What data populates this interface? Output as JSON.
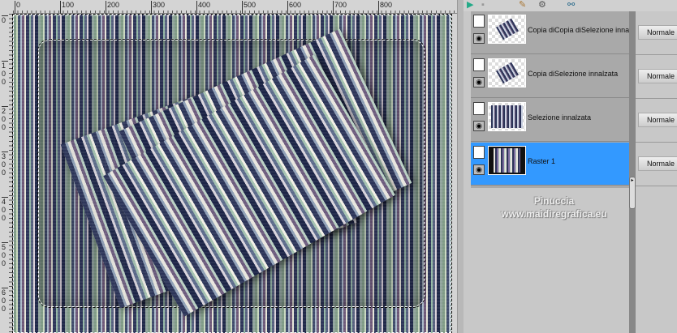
{
  "rulers": {
    "top": [
      "0",
      "100",
      "200",
      "300",
      "400",
      "500",
      "600",
      "700",
      "800"
    ],
    "left": [
      "0",
      "100",
      "200",
      "300",
      "400",
      "500",
      "600"
    ]
  },
  "toolbar": {
    "icons": [
      "select-layer-icon",
      "layer-mask-icon",
      "edit-layer-icon",
      "merge-icon",
      "link-icon"
    ]
  },
  "layers": [
    {
      "name": "Copia diCopia diSelezione innalzata",
      "blend": "Normale",
      "selected": false,
      "thumb": "transparent"
    },
    {
      "name": "Copia diSelezione innalzata",
      "blend": "Normale",
      "selected": false,
      "thumb": "transparent"
    },
    {
      "name": "Selezione innalzata",
      "blend": "Normale",
      "selected": false,
      "thumb": "full"
    },
    {
      "name": "Raster 1",
      "blend": "Normale",
      "selected": true,
      "thumb": "film"
    }
  ],
  "watermark": {
    "line1": "Pinuccia",
    "line2": "www.maidiregrafica.eu"
  },
  "colors": {
    "selected_row": "#3399ff",
    "panel": "#a9a9a9"
  }
}
